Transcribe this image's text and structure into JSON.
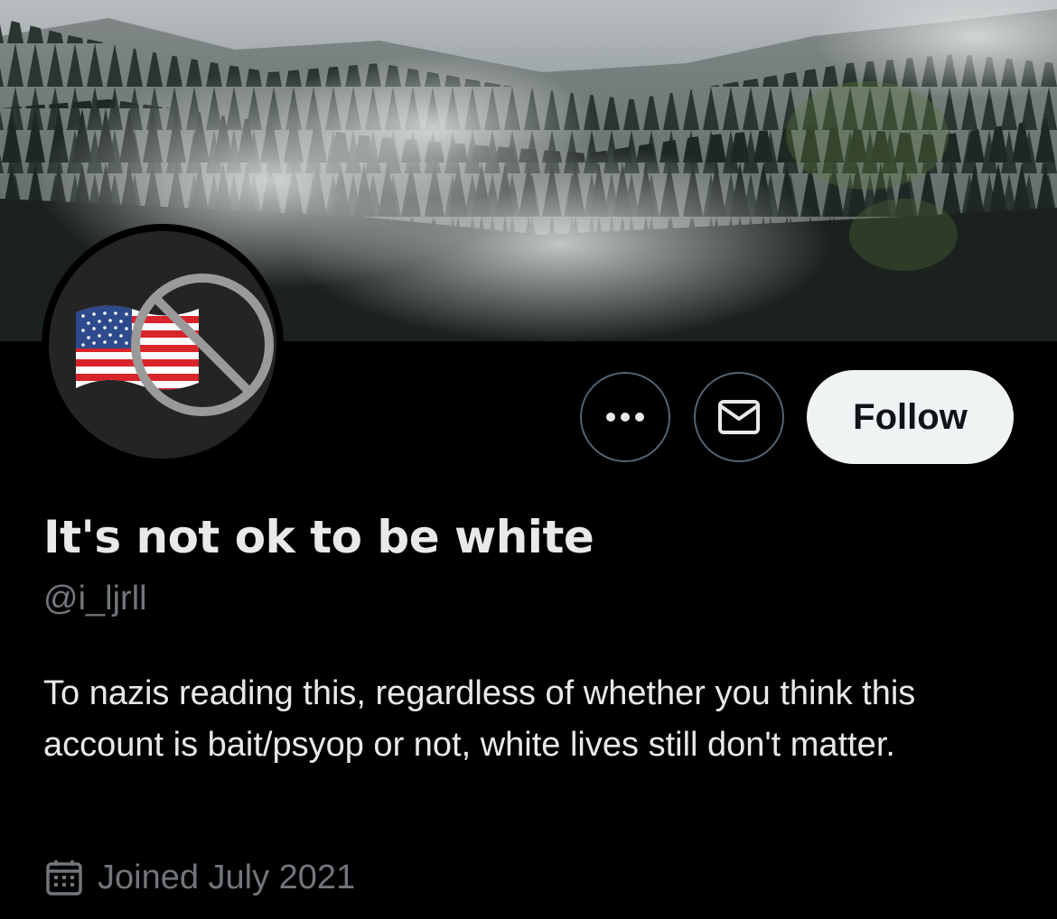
{
  "profile": {
    "display_name": "It's not ok to be white",
    "handle": "@i_ljrll",
    "bio": "To nazis reading this, regardless of whether you think this account is bait/psyop or not, white lives still don't matter.",
    "joined": "Joined July 2021"
  },
  "actions": {
    "follow_label": "Follow",
    "more_icon": "ellipsis-icon",
    "message_icon": "envelope-icon"
  },
  "icons": {
    "avatar": "us-flag-prohibited-icon",
    "joined": "calendar-icon"
  },
  "colors": {
    "background": "#000000",
    "text_primary": "#e7e9ea",
    "text_secondary": "#71767b",
    "button_border": "#536471",
    "follow_bg": "#eff3f4"
  }
}
